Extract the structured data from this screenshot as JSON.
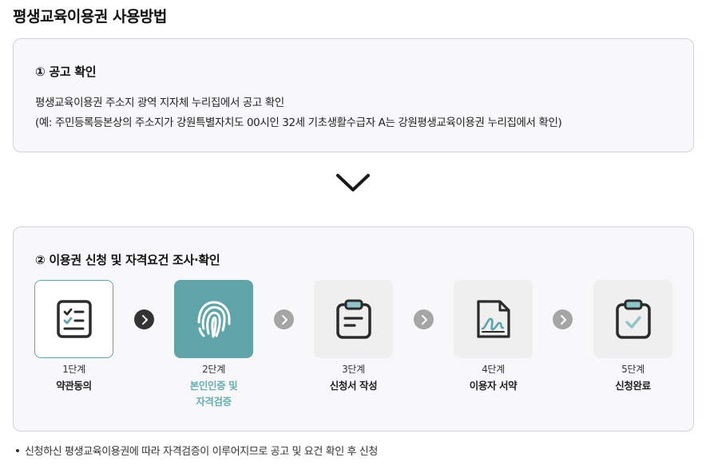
{
  "page": {
    "title": "평생교육이용권 사용방법"
  },
  "section1": {
    "heading": "① 공고 확인",
    "line1": "평생교육이용권 주소지 광역 지자체 누리집에서 공고 확인",
    "line2": "(예: 주민등록등본상의 주소지가 강원특별자치도 00시인 32세 기초생활수급자 A는 강원평생교육이용권 누리집에서 확인)"
  },
  "section2": {
    "heading": "② 이용권 신청 및 자격요건 조사·확인",
    "steps": [
      {
        "number": "1단계",
        "name": "약관동의",
        "icon": "checklist-icon",
        "state": "done"
      },
      {
        "number": "2단계",
        "name_line1": "본인인증 및",
        "name_line2": "자격검증",
        "icon": "fingerprint-icon",
        "state": "active"
      },
      {
        "number": "3단계",
        "name": "신청서 작성",
        "icon": "clipboard-form-icon",
        "state": "pending"
      },
      {
        "number": "4단계",
        "name": "이용자 서약",
        "icon": "signed-document-icon",
        "state": "pending"
      },
      {
        "number": "5단계",
        "name": "신청완료",
        "icon": "clipboard-check-icon",
        "state": "pending"
      }
    ]
  },
  "note": "신청하신 평생교육이용권에 따라 자격검증이 이루어지므로 공고 및 요건 확인 후 신청",
  "colors": {
    "accent": "#5ea4a8",
    "accent_text": "#6aaeb2",
    "box_background": "#f8f8fb",
    "box_border": "#cfd3d9",
    "tile_inactive": "#efefef",
    "arrow_active": "#333333",
    "arrow_inactive": "#a5a5a5"
  }
}
